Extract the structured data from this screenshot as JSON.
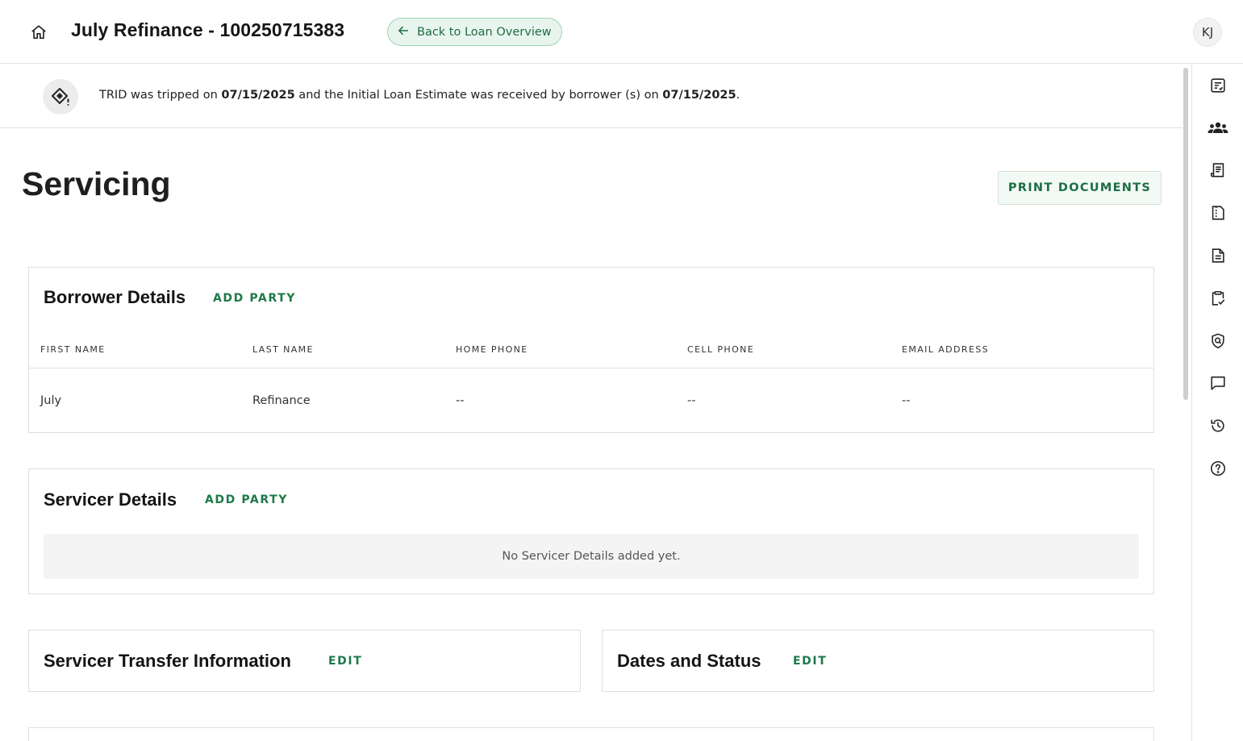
{
  "header": {
    "title": "July Refinance - 100250715383",
    "back_label": "Back to Loan Overview",
    "avatar_initials": "KJ"
  },
  "notice": {
    "prefix": "TRID was tripped on ",
    "tripped_date": "07/15/2025",
    "middle": " and the Initial Loan Estimate was received by borrower (s) on ",
    "received_date": "07/15/2025",
    "suffix": "."
  },
  "page": {
    "title": "Servicing",
    "print_label": "PRINT DOCUMENTS"
  },
  "borrower_details": {
    "title": "Borrower Details",
    "action": "ADD PARTY",
    "columns": [
      "FIRST NAME",
      "LAST NAME",
      "HOME PHONE",
      "CELL PHONE",
      "EMAIL ADDRESS"
    ],
    "rows": [
      [
        "July",
        "Refinance",
        "--",
        "--",
        "--"
      ]
    ]
  },
  "servicer_details": {
    "title": "Servicer Details",
    "action": "ADD PARTY",
    "empty_message": "No Servicer Details added yet."
  },
  "servicer_transfer": {
    "title": "Servicer Transfer Information",
    "action": "EDIT"
  },
  "dates_status": {
    "title": "Dates and Status",
    "action": "EDIT"
  },
  "rail": {
    "icons": [
      "checklist-doc-icon",
      "people-group-icon",
      "receipt-icon",
      "document-fold-icon",
      "document-lines-icon",
      "clipboard-check-icon",
      "shield-search-icon",
      "chat-icon",
      "history-icon",
      "help-icon"
    ]
  },
  "colors": {
    "accent_green": "#1d7a48",
    "back_pill_bg": "#e8f5ee"
  }
}
